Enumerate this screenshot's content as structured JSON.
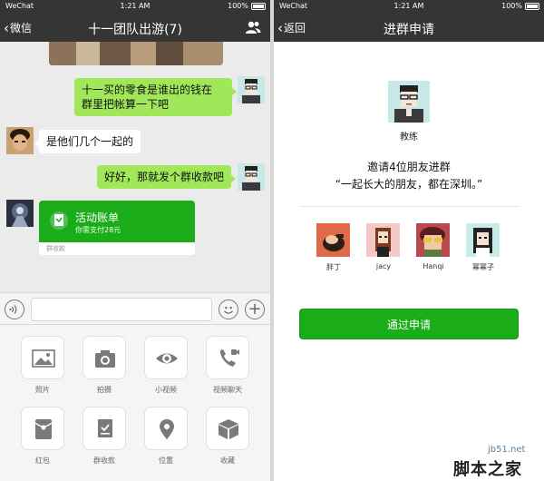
{
  "status_bar": {
    "carrier": "WeChat",
    "time": "1:21 AM",
    "battery": "100%"
  },
  "chat": {
    "back_label": "微信",
    "title": "十一团队出游(7)",
    "messages": [
      {
        "side": "right",
        "text_line1": "十一买的零食是谁出的钱在",
        "text_line2": "群里把帐算一下吧"
      },
      {
        "side": "left",
        "text": "是他们几个一起的"
      },
      {
        "side": "right",
        "text": "好好，那就发个群收款吧"
      }
    ],
    "payment_card": {
      "title": "活动账单",
      "subtitle": "你需支付28元",
      "footer": "群收款"
    },
    "panel_items": [
      {
        "label": "照片",
        "icon": "photo-icon"
      },
      {
        "label": "拍摄",
        "icon": "camera-icon"
      },
      {
        "label": "小视频",
        "icon": "eye-icon"
      },
      {
        "label": "视频聊天",
        "icon": "video-call-icon"
      },
      {
        "label": "红包",
        "icon": "red-packet-icon"
      },
      {
        "label": "群收款",
        "icon": "group-payment-icon"
      },
      {
        "label": "位置",
        "icon": "location-icon"
      },
      {
        "label": "收藏",
        "icon": "favorites-box-icon"
      }
    ]
  },
  "invite": {
    "back_label": "返回",
    "title": "进群申请",
    "inviter_name": "教练",
    "invite_text": "邀请4位朋友进群",
    "group_name": "“一起长大的朋友，都在深圳。”",
    "friends": [
      {
        "name": "胖丁"
      },
      {
        "name": "jacy"
      },
      {
        "name": "Hanqi"
      },
      {
        "name": "幂幂子"
      }
    ],
    "approve_label": "通过申请"
  },
  "watermark": {
    "site": "jb51.net",
    "brand": "脚本之家"
  },
  "colors": {
    "nav_bg": "#353535",
    "bubble_green": "#a0e75a",
    "wechat_green": "#1aad19",
    "chat_bg": "#ebebeb"
  }
}
